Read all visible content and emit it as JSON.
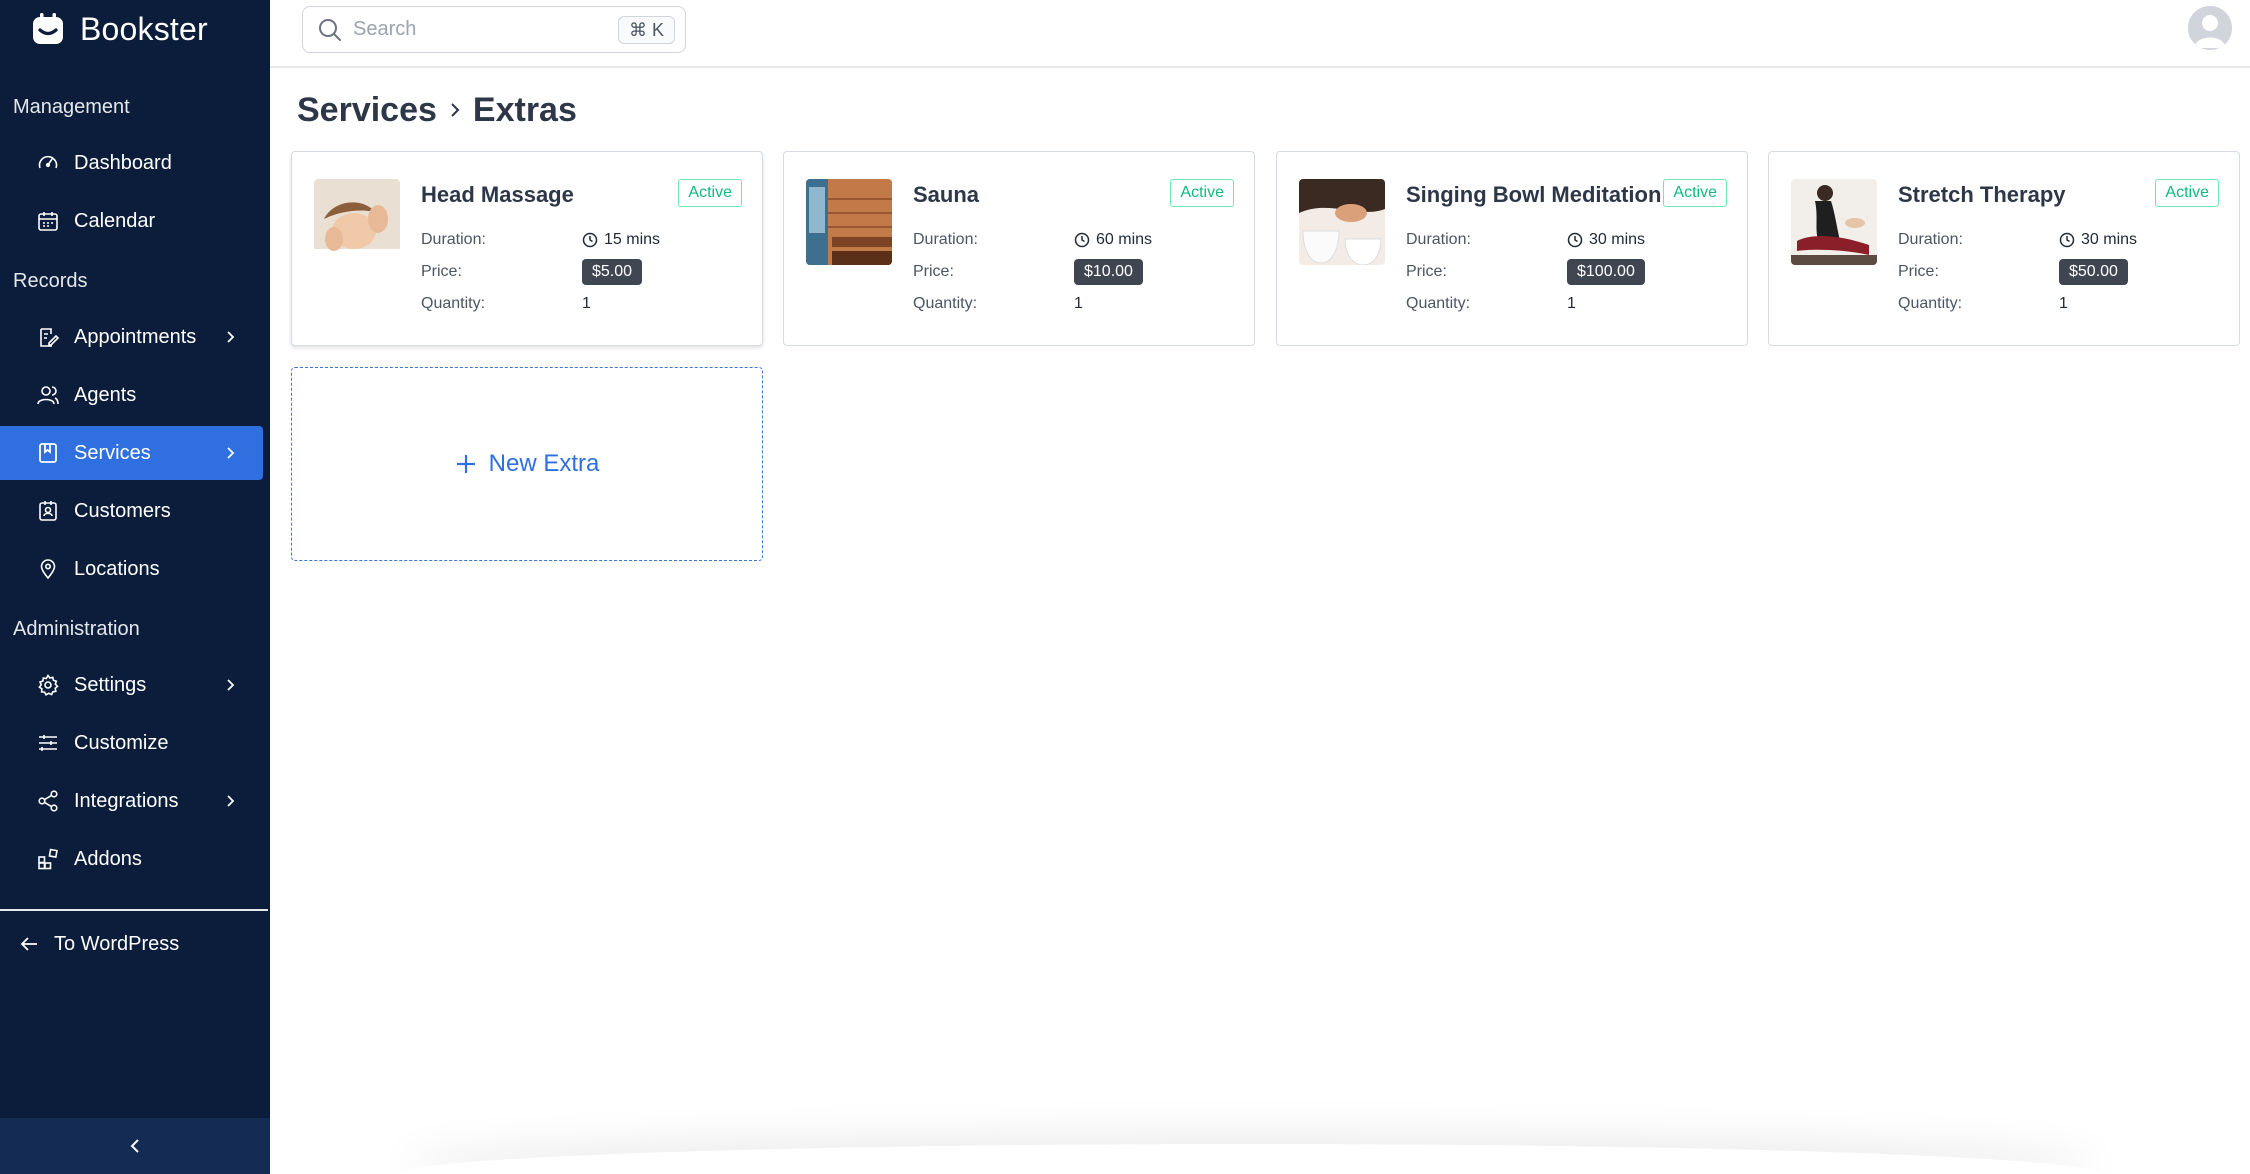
{
  "brand": {
    "name": "Bookster"
  },
  "sidebar": {
    "sections": {
      "management": "Management",
      "records": "Records",
      "administration": "Administration"
    },
    "items": {
      "dashboard": "Dashboard",
      "calendar": "Calendar",
      "appointments": "Appointments",
      "agents": "Agents",
      "services": "Services",
      "customers": "Customers",
      "locations": "Locations",
      "settings": "Settings",
      "customize": "Customize",
      "integrations": "Integrations",
      "addons": "Addons"
    },
    "active_item": "Services",
    "to_wordpress": "To WordPress"
  },
  "search": {
    "placeholder": "Search",
    "shortcut": "⌘ K"
  },
  "breadcrumb": {
    "parent": "Services",
    "current": "Extras"
  },
  "labels": {
    "duration": "Duration:",
    "price": "Price:",
    "quantity": "Quantity:"
  },
  "extras": [
    {
      "title": "Head Massage",
      "status": "Active",
      "duration": "15 mins",
      "price": "$5.00",
      "quantity": "1"
    },
    {
      "title": "Sauna",
      "status": "Active",
      "duration": "60 mins",
      "price": "$10.00",
      "quantity": "1"
    },
    {
      "title": "Singing Bowl Meditation",
      "status": "Active",
      "duration": "30 mins",
      "price": "$100.00",
      "quantity": "1"
    },
    {
      "title": "Stretch Therapy",
      "status": "Active",
      "duration": "30 mins",
      "price": "$50.00",
      "quantity": "1"
    }
  ],
  "new_extra_label": "New Extra",
  "colors": {
    "sidebar_bg": "#0b1d3a",
    "accent": "#2f6fe0",
    "active_badge": "#10b981",
    "price_pill": "#3f4652"
  }
}
